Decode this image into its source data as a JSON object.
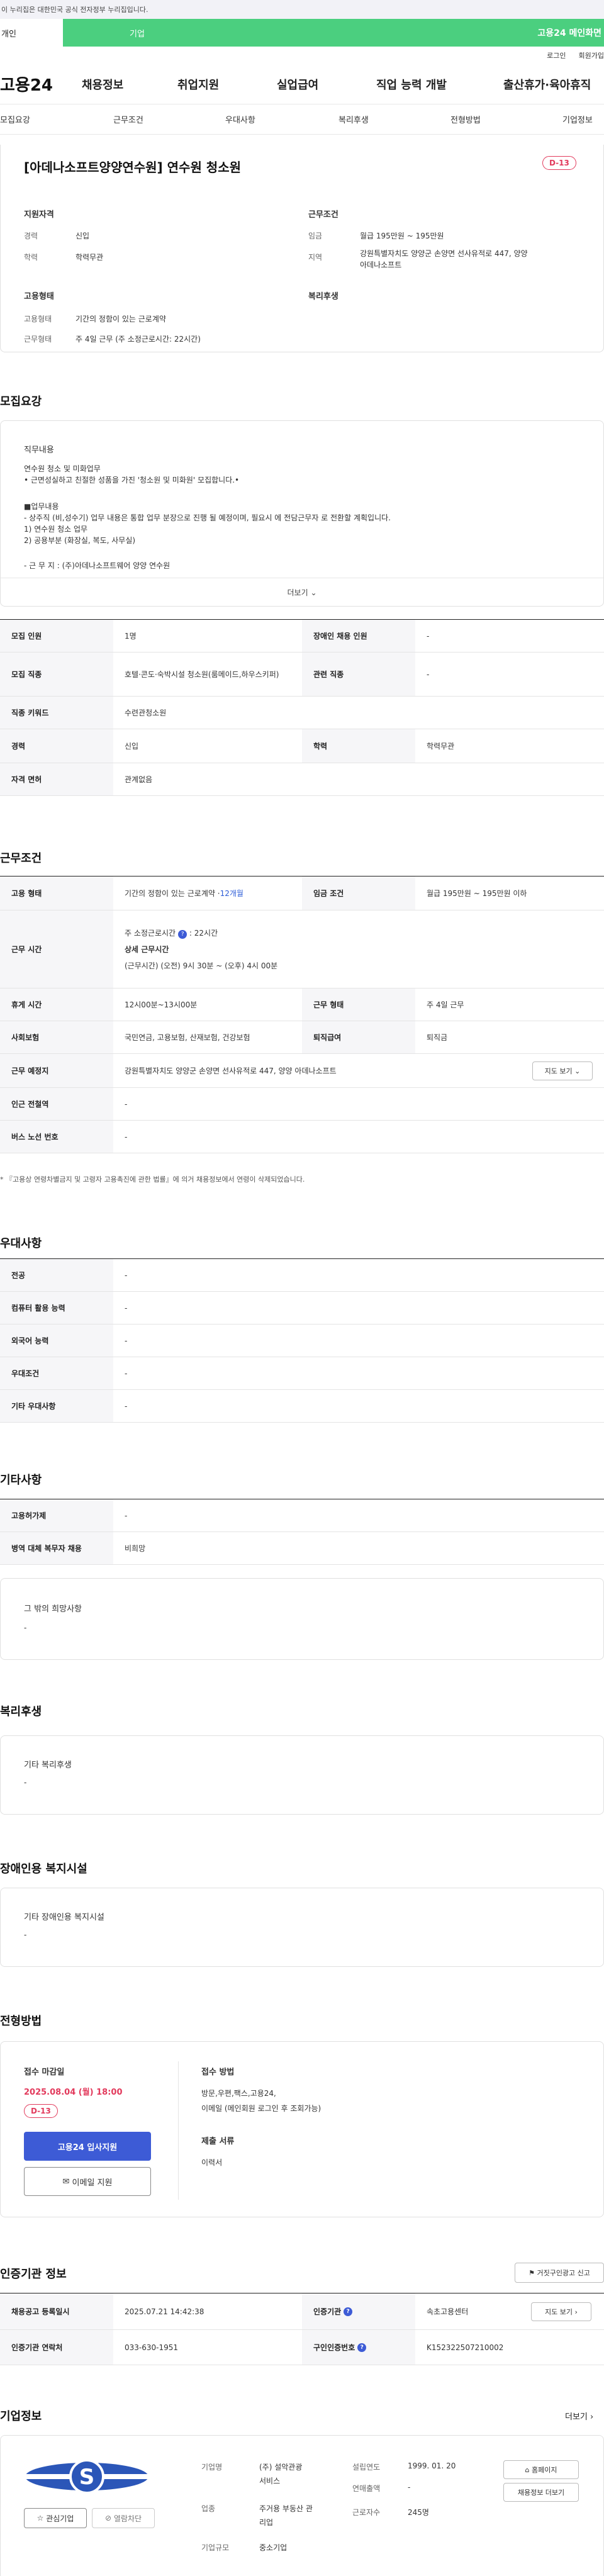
{
  "top": {
    "gov_notice": "이 누리집은 대한민국 공식 전자정부 누리집입니다.",
    "tab_personal": "개인",
    "tab_company": "기업",
    "brand": "고용24 메인화면"
  },
  "util": {
    "login": "로그인",
    "signup": "회원가입"
  },
  "gnb": {
    "logo": "고용24",
    "items": [
      "채용정보",
      "취업지원",
      "실업급여",
      "직업 능력 개발",
      "출산휴가·육아휴직"
    ]
  },
  "subnav": [
    "모집요강",
    "근무조건",
    "우대사항",
    "복리후생",
    "전형방법",
    "기업정보"
  ],
  "summary": {
    "title": "[아데나소프트양양연수원] 연수원 청소원",
    "dday": "D-13",
    "qual_label": "지원자격",
    "career_k": "경력",
    "career_v": "신입",
    "edu_k": "학력",
    "edu_v": "학력무관",
    "cond_label": "근무조건",
    "wage_k": "임금",
    "wage_v": "월급 195만원 ~ 195만원",
    "region_k": "지역",
    "region_v1": "강원특별자치도 양양군 손양면 선사유적로 447, 양양",
    "region_v2": "아데나소프트",
    "emp_label": "고용형태",
    "emptype_k": "고용형태",
    "emptype_v": "기간의 정함이 있는 근로계약",
    "worktype_k": "근무형태",
    "worktype_v": "주 4일 근무 (주 소정근로시간: 22시간)",
    "welfare_label": "복리후생"
  },
  "recruit": {
    "section_title": "모집요강",
    "job_title": "직무내용",
    "lines": [
      "연수원 청소 및 미화업무",
      "• 근면성실하고 친절한 성품을 가진 '청소원 및 미화원' 모집합니다.•",
      "",
      "■업무내용",
      "- 상주직 (비,성수기) 업무 내용은 통합 업무 분장으로 진행 될 예정이며, 필요시 에 전담근무자 로 전환할 계획입니다.",
      "1) 연수원 청소 업무",
      "2) 공용부분 (화장실, 복도, 사무실)",
      "",
      "- 근 무 지 : (주)아데나소프트웨어 양양 연수원"
    ],
    "more": "더보기",
    "rows": [
      {
        "k1": "모집 인원",
        "v1": "1명",
        "k2": "장애인 채용 인원",
        "v2": "-"
      },
      {
        "k1": "모집 직종",
        "v1": "호텔·콘도·숙박시설 청소원(룸메이드,하우스키퍼)",
        "k2": "관련 직종",
        "v2": "-"
      },
      {
        "k1": "직종 키워드",
        "v1": "수련관청소원"
      },
      {
        "k1": "경력",
        "v1": "신입",
        "k2": "학력",
        "v2": "학력무관"
      },
      {
        "k1": "자격 면허",
        "v1": "관계없음"
      }
    ]
  },
  "conditions": {
    "section_title": "근무조건",
    "emp_k": "고용 형태",
    "emp_v": "기간의 정함이 있는 근로계약 · ",
    "emp_v_blue": "12개월",
    "wage_k": "임금 조건",
    "wage_v": "월급 195만원 ~ 195만원 이하",
    "hours_k": "근무 시간",
    "hours_v1": "주 소정근로시간",
    "hours_v1b": "22시간",
    "hours_v2": "상세 근무시간",
    "hours_v3": "(근무시간) (오전) 9시 30분 ~ (오후) 4시 00분",
    "break_k": "휴게 시간",
    "break_v": "12시00분~13시00분",
    "form_k": "근무 형태",
    "form_v": "주 4일 근무",
    "ins_k": "사회보험",
    "ins_v": "국민연금, 고용보험, 산재보험, 건강보험",
    "ret_k": "퇴직급여",
    "ret_v": "퇴직금",
    "loc_k": "근무 예정지",
    "loc_v": "강원특별자치도 양양군 손양면 선사유적로 447, 양양 아데나소프트",
    "map_btn": "지도 보기",
    "station_k": "인근 전철역",
    "station_v": "-",
    "bus_k": "버스 노선 번호",
    "bus_v": "-",
    "note": "* 『고용상 연령차별금지 및 고령자 고용촉진에 관한 법률』에 의거 채용정보에서 연령이 삭제되었습니다."
  },
  "preference": {
    "section_title": "우대사항",
    "rows": [
      {
        "k": "전공",
        "v": "-"
      },
      {
        "k": "컴퓨터 활용 능력",
        "v": "-"
      },
      {
        "k": "외국어 능력",
        "v": "-"
      },
      {
        "k": "우대조건",
        "v": "-"
      },
      {
        "k": "기타 우대사항",
        "v": "-"
      }
    ]
  },
  "others": {
    "section_title": "기타사항",
    "rows": [
      {
        "k": "고용허가제",
        "v": "-"
      },
      {
        "k": "병역 대체 복무자 채용",
        "v": "비희망"
      }
    ],
    "box_title": "그 밖의 희망사항",
    "box_v": "-"
  },
  "welfare": {
    "section_title": "복리후생",
    "box_title": "기타 복리후생",
    "box_v": "-"
  },
  "disability": {
    "section_title": "장애인용 복지시설",
    "box_title": "기타 장애인용 복지시설",
    "box_v": "-"
  },
  "process": {
    "section_title": "전형방법",
    "deadline_label": "접수 마감일",
    "deadline_v": "2025.08.04 (월) 18:00",
    "dday": "D-13",
    "apply_btn": "고용24 입사지원",
    "email_btn": "이메일 지원",
    "method_label": "접수 방법",
    "method_v1": "방문,우편,팩스,고용24,",
    "method_v2": "이메일 (메인회원 로그인 후 조회가능)",
    "docs_label": "제출 서류",
    "docs_v": "이력서"
  },
  "agency": {
    "section_title": "인증기관 정보",
    "report_btn": "거짓구인광고 신고",
    "reg_k": "채용공고 등록일시",
    "reg_v": "2025.07.21 14:42:38",
    "org_k": "인증기관",
    "org_v": "속초고용센터",
    "map_btn": "지도 보기",
    "tel_k": "인증기관 연락처",
    "tel_v": "033-630-1951",
    "num_k": "구인인증번호",
    "num_v": "K152322507210002"
  },
  "company": {
    "section_title": "기업정보",
    "more": "더보기",
    "interest_btn": "관심기업",
    "block_btn": "열람차단",
    "name_k": "기업명",
    "name_v1": "(주) 설악관광",
    "name_v2": "서비스",
    "ind_k": "업종",
    "ind_v1": "주거용 부동산 관",
    "ind_v2": "리업",
    "size_k": "기업규모",
    "size_v": "중소기업",
    "est_k": "설립연도",
    "est_v": "1999. 01. 20",
    "sales_k": "연매출액",
    "sales_v": "-",
    "emp_k": "근로자수",
    "emp_v": "245명",
    "home_btn": "홈페이지",
    "list_btn": "채용정보 더보기"
  }
}
